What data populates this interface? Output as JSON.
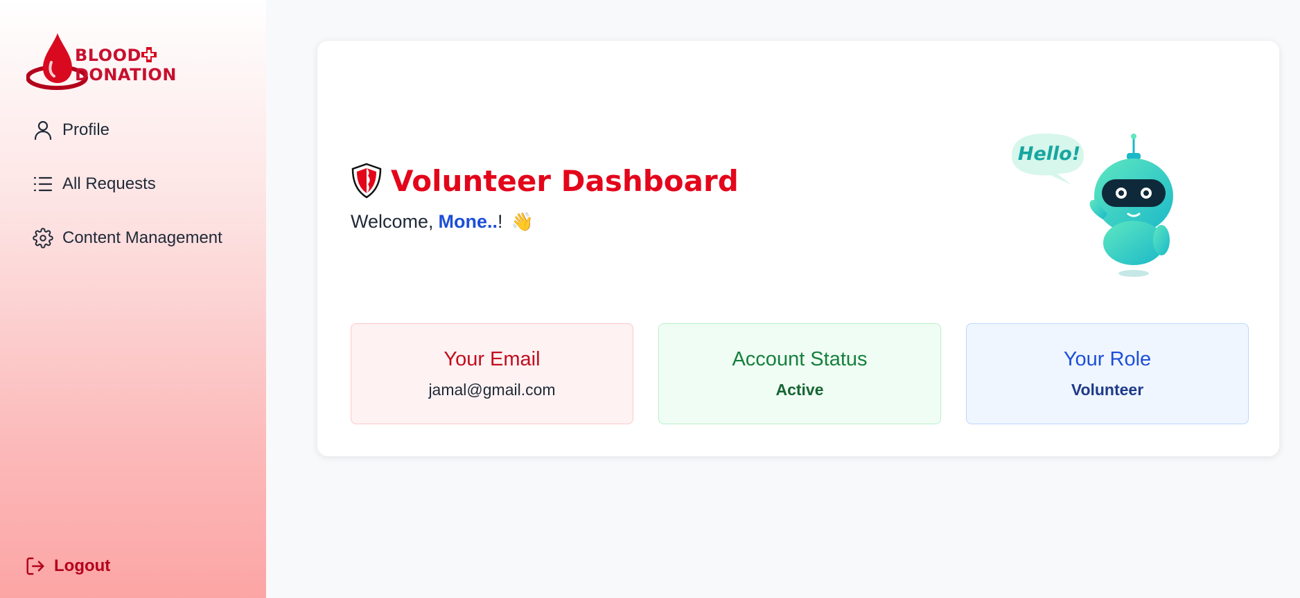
{
  "sidebar": {
    "logo": {
      "line1": "BLOOD",
      "line2": "DONATION",
      "icon": "blood-drop-icon"
    },
    "items": [
      {
        "label": "Profile",
        "icon": "user-icon"
      },
      {
        "label": "All Requests",
        "icon": "list-icon"
      },
      {
        "label": "Content Management",
        "icon": "gear-icon"
      }
    ],
    "logout": {
      "label": "Logout",
      "icon": "logout-icon"
    }
  },
  "main": {
    "title": "Volunteer Dashboard",
    "welcome_prefix": "Welcome,",
    "user_name": "Mone..",
    "welcome_suffix": "!",
    "wave_emoji": "👋",
    "robot_bubble": "Hello!"
  },
  "stats": [
    {
      "label": "Your Email",
      "value": "jamal@gmail.com"
    },
    {
      "label": "Account Status",
      "value": "Active"
    },
    {
      "label": "Your Role",
      "value": "Volunteer"
    }
  ],
  "colors": {
    "brand_red": "#e3061b",
    "accent_blue": "#1d4ed8",
    "success_green": "#15803d"
  }
}
